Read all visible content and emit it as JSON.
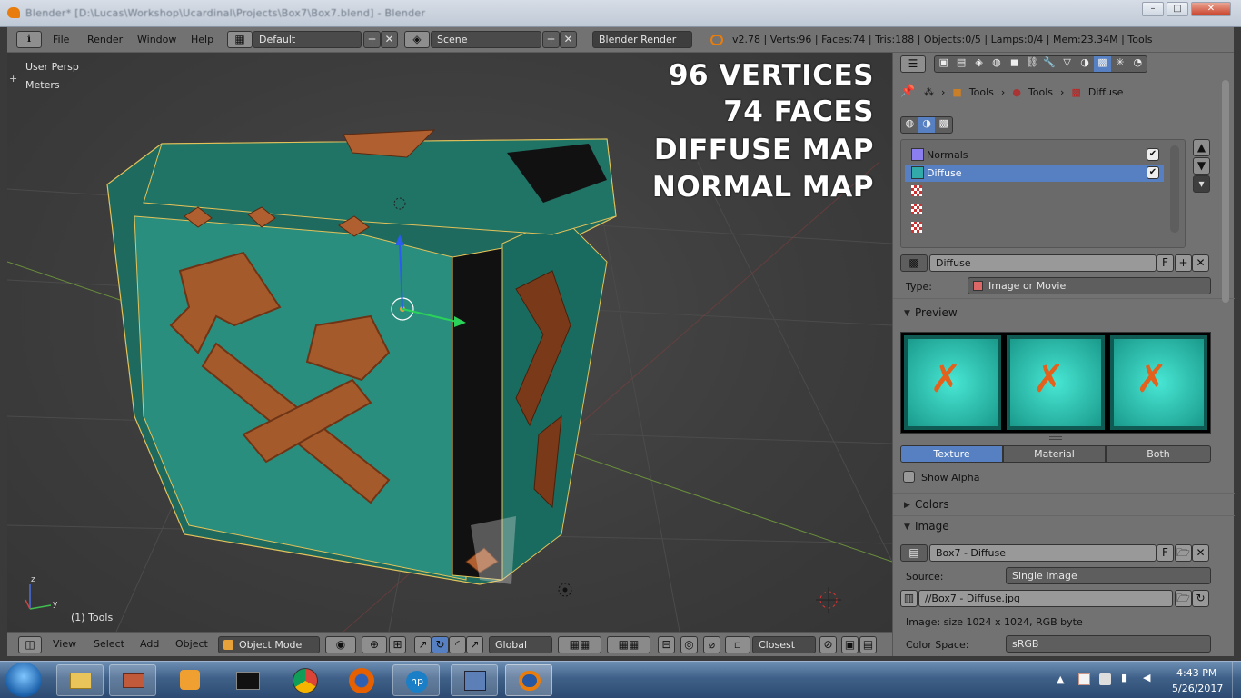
{
  "window": {
    "title": "Blender* [D:\\Lucas\\Workshop\\Ucardinal\\Projects\\Box7\\Box7.blend] - Blender",
    "min": "–",
    "max": "□",
    "close": "✕"
  },
  "menubar": {
    "info_icon": "ℹ",
    "menus": [
      "File",
      "Render",
      "Window",
      "Help"
    ],
    "layout": "Default",
    "scene": "Scene",
    "engine": "Blender Render",
    "stats": "v2.78 | Verts:96 | Faces:74 | Tris:188 | Objects:0/5 | Lamps:0/4 | Mem:23.34M | Tools"
  },
  "viewport": {
    "view_name": "User Persp",
    "units": "Meters",
    "overlay": [
      "96 VERTICES",
      "74 FACES",
      "DIFFUSE MAP",
      "NORMAL MAP"
    ],
    "active_object": "(1) Tools",
    "axis_z": "z",
    "axis_y": "y"
  },
  "viewport_header": {
    "menus": [
      "View",
      "Select",
      "Add",
      "Object"
    ],
    "mode": "Object Mode",
    "orientation": "Global",
    "snap": "Closest"
  },
  "properties": {
    "breadcrumb": [
      "Tools",
      "Tools",
      "Diffuse"
    ],
    "texture_slots": [
      {
        "name": "Normals",
        "checked": true,
        "selected": false
      },
      {
        "name": "Diffuse",
        "checked": true,
        "selected": true
      },
      {
        "name": "",
        "checked": false,
        "selected": false
      },
      {
        "name": "",
        "checked": false,
        "selected": false
      },
      {
        "name": "",
        "checked": false,
        "selected": false
      }
    ],
    "texture_name": "Diffuse",
    "fake_user": "F",
    "type_label": "Type:",
    "type_value": "Image or Movie",
    "preview_label": "Preview",
    "preview_tabs": [
      "Texture",
      "Material",
      "Both"
    ],
    "show_alpha": "Show Alpha",
    "colors_label": "Colors",
    "image_label": "Image",
    "image_name": "Box7 - Diffuse",
    "source_label": "Source:",
    "source_value": "Single Image",
    "file_path": "//Box7 - Diffuse.jpg",
    "image_info": "Image: size 1024 x 1024, RGB byte",
    "color_space_label": "Color Space:",
    "color_space_value": "sRGB"
  },
  "taskbar": {
    "time": "4:43 PM",
    "date": "5/26/2017"
  },
  "colors": {
    "accent": "#5680c2",
    "panel": "#727272",
    "viewport": "#3d3d3d"
  }
}
